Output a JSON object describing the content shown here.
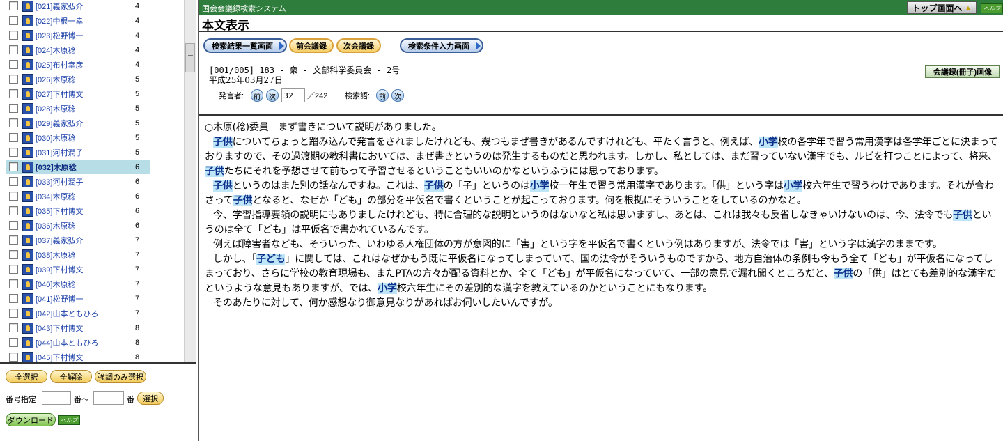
{
  "speaker_list": {
    "rows": [
      {
        "label": "[021]義家弘介",
        "count": "4"
      },
      {
        "label": "[022]中根一幸",
        "count": "4"
      },
      {
        "label": "[023]松野博一",
        "count": "4"
      },
      {
        "label": "[024]木原稔",
        "count": "4"
      },
      {
        "label": "[025]布村幸彦",
        "count": "4"
      },
      {
        "label": "[026]木原稔",
        "count": "5"
      },
      {
        "label": "[027]下村博文",
        "count": "5"
      },
      {
        "label": "[028]木原稔",
        "count": "5"
      },
      {
        "label": "[029]義家弘介",
        "count": "5"
      },
      {
        "label": "[030]木原稔",
        "count": "5"
      },
      {
        "label": "[031]河村潤子",
        "count": "5"
      },
      {
        "label": "[032]木原稔",
        "count": "6"
      },
      {
        "label": "[033]河村潤子",
        "count": "6"
      },
      {
        "label": "[034]木原稔",
        "count": "6"
      },
      {
        "label": "[035]下村博文",
        "count": "6"
      },
      {
        "label": "[036]木原稔",
        "count": "6"
      },
      {
        "label": "[037]義家弘介",
        "count": "7"
      },
      {
        "label": "[038]木原稔",
        "count": "7"
      },
      {
        "label": "[039]下村博文",
        "count": "7"
      },
      {
        "label": "[040]木原稔",
        "count": "7"
      },
      {
        "label": "[041]松野博一",
        "count": "7"
      },
      {
        "label": "[042]山本ともひろ",
        "count": "7"
      },
      {
        "label": "[043]下村博文",
        "count": "8"
      },
      {
        "label": "[044]山本ともひろ",
        "count": "8"
      },
      {
        "label": "[045]下村博文",
        "count": "8"
      }
    ],
    "selected_index": 11
  },
  "left_controls": {
    "select_all": "全選択",
    "deselect_all": "全解除",
    "select_emphasis": "強調のみ選択",
    "range_label": "番号指定",
    "range_mid": "番〜",
    "range_end": "番",
    "select": "選択",
    "download": "ダウンロード",
    "help": "ヘルプ"
  },
  "header": {
    "app_title": "国会会議録検索システム",
    "top_button": "トップ画面へ",
    "help": "ヘルプ"
  },
  "page_title": "本文表示",
  "nav": {
    "results_list": "検索結果一覧画面",
    "prev_meeting": "前会議録",
    "next_meeting": "次会議録",
    "search_conditions": "検索条件入力画面"
  },
  "meeting": {
    "line1": "[001/005] 183 - 衆 - 文部科学委員会 - 2号",
    "line2": "平成25年03月27日",
    "booklet_button": "会議録(冊子)画像"
  },
  "speaker_nav": {
    "label": "発言者:",
    "prev": "前",
    "next": "次",
    "current": "32",
    "total": "／242",
    "term_label": "検索語:",
    "term_prev": "前",
    "term_next": "次"
  },
  "speech": {
    "paragraphs": [
      [
        {
          "t": "○木原(稔)委員　まず書きについて説明がありました。"
        }
      ],
      [
        {
          "t": "子供",
          "hl": true
        },
        {
          "t": "についてちょっと踏み込んで発言をされましたけれども、幾つもまぜ書きがあるんですけれども、平たく言うと、例えば、"
        },
        {
          "t": "小学",
          "hl": true
        },
        {
          "t": "校の各学年で習う常用漢字は各学年ごとに決まっておりますので、その過渡期の教科書においては、まぜ書きというのは発生するものだと思われます。しかし、私としては、まだ習っていない漢字でも、ルビを打つことによって、将来、"
        },
        {
          "t": "子供",
          "hl": true
        },
        {
          "t": "たちにそれを予想させて前もって予習させるということもいいのかなというふうには思っております。"
        }
      ],
      [
        {
          "t": "子供",
          "hl": true
        },
        {
          "t": "というのはまた別の話なんですね。これは、"
        },
        {
          "t": "子供",
          "hl": true
        },
        {
          "t": "の「子」というのは"
        },
        {
          "t": "小学",
          "hl": true
        },
        {
          "t": "校一年生で習う常用漢字であります。「供」という字は"
        },
        {
          "t": "小学",
          "hl": true
        },
        {
          "t": "校六年生で習うわけであります。それが合わさって"
        },
        {
          "t": "子供",
          "hl": true
        },
        {
          "t": "となると、なぜか「ども」の部分を平仮名で書くということが起こっております。何を根拠にそういうことをしているのかなと。"
        }
      ],
      [
        {
          "t": "今、学習指導要領の説明にもありましたけれども、特に合理的な説明というのはないなと私は思いますし、あとは、これは我々も反省しなきゃいけないのは、今、法令でも"
        },
        {
          "t": "子供",
          "hl": true
        },
        {
          "t": "というのは全て「ども」は平仮名で書かれているんです。"
        }
      ],
      [
        {
          "t": "例えば障害者なども、そういった、いわゆる人権団体の方が意図的に「害」という字を平仮名で書くという例はありますが、法令では「害」という字は漢字のままです。"
        }
      ],
      [
        {
          "t": "しかし、「"
        },
        {
          "t": "子ども",
          "hl": true
        },
        {
          "t": "」に関しては、これはなぜかもう既に平仮名になってしまっていて、国の法令がそういうものですから、地方自治体の条例も今もう全て「ども」が平仮名になってしまっており、さらに学校の教育現場も、またPTAの方々が配る資料とか、全て「ども」が平仮名になっていて、一部の意見で漏れ聞くところだと、"
        },
        {
          "t": "子供",
          "hl": true
        },
        {
          "t": "の「供」はとても差別的な漢字だというような意見もありますが、では、"
        },
        {
          "t": "小学",
          "hl": true
        },
        {
          "t": "校六年生にその差別的な漢字を教えているのかということにもなります。"
        }
      ],
      [
        {
          "t": "そのあたりに対して、何か感想なり御意見なりがあればお伺いしたいんですが。"
        }
      ]
    ]
  }
}
